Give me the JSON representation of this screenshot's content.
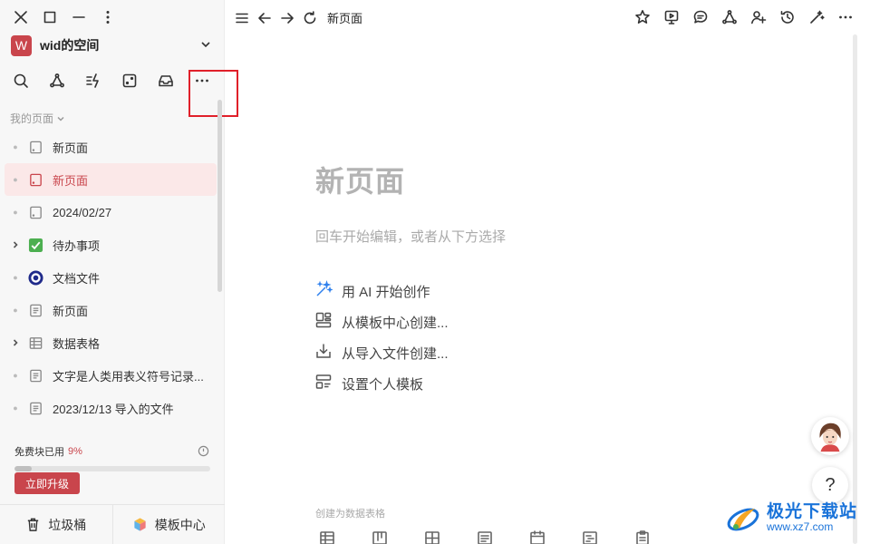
{
  "sidebar": {
    "window_controls": [
      "close-icon",
      "maximize-icon",
      "minimize-icon",
      "more-vertical-icon"
    ],
    "workspace": {
      "avatar_letter": "W",
      "name": "wid的空间",
      "avatar_color": "#c9454c"
    },
    "toolbar": [
      "search-icon",
      "graph-icon",
      "quick-actions-icon",
      "random-page-icon",
      "inbox-icon",
      "more-icon"
    ],
    "section_label": "我的页面",
    "items": [
      {
        "label": "新页面",
        "icon": "blank-page-icon",
        "expandable": false,
        "active": false
      },
      {
        "label": "新页面",
        "icon": "blank-page-icon",
        "expandable": false,
        "active": true
      },
      {
        "label": "2024/02/27",
        "icon": "blank-page-icon",
        "expandable": false,
        "active": false
      },
      {
        "label": "待办事项",
        "icon": "checkbox-icon",
        "expandable": true,
        "active": false
      },
      {
        "label": "文档文件",
        "icon": "circle-target-icon",
        "expandable": false,
        "active": false
      },
      {
        "label": "新页面",
        "icon": "document-icon",
        "expandable": false,
        "active": false
      },
      {
        "label": "数据表格",
        "icon": "table-icon",
        "expandable": true,
        "active": false
      },
      {
        "label": "文字是人类用表义符号记录...",
        "icon": "document-icon",
        "expandable": false,
        "active": false
      },
      {
        "label": "2023/12/13 导入的文件",
        "icon": "document-icon",
        "expandable": false,
        "active": false
      }
    ],
    "usage": {
      "label": "免费块已用",
      "percent_text": "9%",
      "percent": 0.09
    },
    "upgrade_label": "立即升级",
    "bottom": {
      "trash_label": "垃圾桶",
      "templates_label": "模板中心"
    }
  },
  "topbar": {
    "title": "新页面",
    "actions": [
      "star-icon",
      "present-icon",
      "comment-icon",
      "graph-icon",
      "share-user-icon",
      "history-icon",
      "ai-magic-icon",
      "more-icon"
    ]
  },
  "main": {
    "title": "新页面",
    "hint": "回车开始编辑，或者从下方选择",
    "actions": [
      {
        "label": "用 AI 开始创作",
        "icon": "ai-magic-icon"
      },
      {
        "label": "从模板中心创建...",
        "icon": "template-icon"
      },
      {
        "label": "从导入文件创建...",
        "icon": "import-icon"
      },
      {
        "label": "设置个人模板",
        "icon": "personal-template-icon"
      }
    ],
    "database_label": "创建为数据表格"
  },
  "help_label": "?",
  "watermark": {
    "main": "极光下载站",
    "sub": "www.xz7.com"
  },
  "colors": {
    "accent": "#c9454c",
    "highlight_box": "#e0202a",
    "watermark": "#1a73d9"
  }
}
